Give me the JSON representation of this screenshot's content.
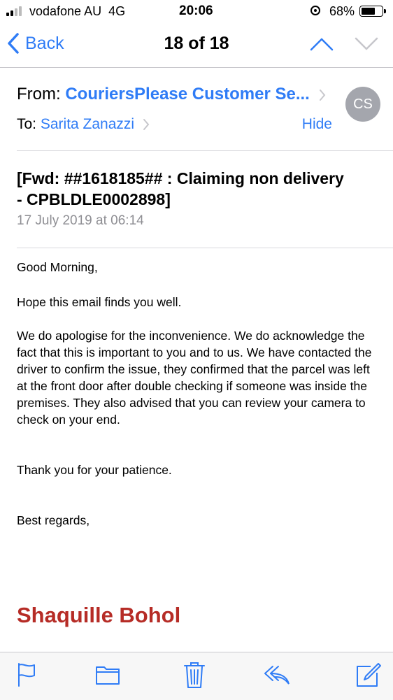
{
  "status_bar": {
    "carrier": "vodafone AU",
    "network": "4G",
    "time": "20:06",
    "battery_percent": "68%",
    "battery_level": 0.68
  },
  "nav": {
    "back_label": "Back",
    "title": "18 of 18",
    "accent_color": "#2f7cf6"
  },
  "header": {
    "from_label": "From:",
    "from_value": "CouriersPlease Customer Se...",
    "to_label": "To:",
    "to_value": "Sarita Zanazzi",
    "hide_label": "Hide",
    "avatar_initials": "CS"
  },
  "email": {
    "subject": "[Fwd: ##1618185## : Claiming non delivery - CPBLDLE0002898]",
    "date": "17 July 2019 at 06:14",
    "greeting": "Good Morning,",
    "line1": "Hope this email finds you well.",
    "paragraph": "We do apologise for the inconvenience. We do acknowledge the fact that this is important to you and to us. We have contacted the driver to confirm the issue, they confirmed that the parcel was left at the front door after double checking if someone was inside the premises. They also advised that you can review your camera to check on your end.",
    "thanks": "Thank you for your patience.",
    "closing": "Best regards,",
    "signature": "Shaquille Bohol",
    "signature_color": "#b62c26"
  },
  "toolbar": {
    "icons": [
      "flag-icon",
      "folder-icon",
      "trash-icon",
      "reply-icon",
      "compose-icon"
    ]
  }
}
